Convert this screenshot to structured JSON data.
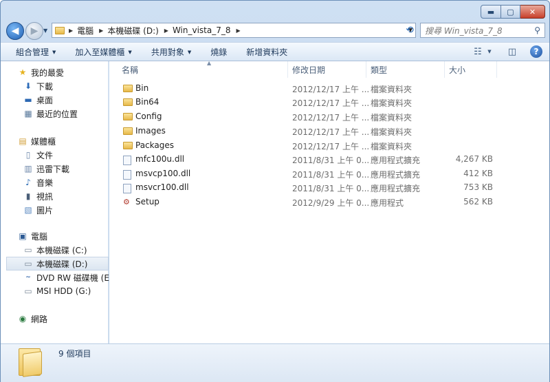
{
  "title_buttons": {
    "minimize": "▬",
    "maximize": "▢",
    "close": "✕"
  },
  "nav": {
    "back": "◀",
    "forward": "▶"
  },
  "address": {
    "crumbs": [
      "電腦",
      "本機磁碟 (D:)",
      "Win_vista_7_8"
    ]
  },
  "search": {
    "placeholder": "搜尋 Win_vista_7_8"
  },
  "toolbar": {
    "organize": "組合管理",
    "include_library": "加入至媒體櫃",
    "share_with": "共用對象",
    "burn": "燒錄",
    "new_folder": "新增資料夾"
  },
  "sidebar": {
    "favorites": {
      "label": "我的最愛",
      "items": [
        "下載",
        "桌面",
        "最近的位置"
      ]
    },
    "libraries": {
      "label": "媒體櫃",
      "items": [
        "文件",
        "迅雷下載",
        "音樂",
        "視訊",
        "圖片"
      ]
    },
    "computer": {
      "label": "電腦",
      "items": [
        "本機磁碟 (C:)",
        "本機磁碟 (D:)",
        "DVD RW 磁碟機 (E:)",
        "MSI HDD (G:)"
      ]
    },
    "network": {
      "label": "網路"
    }
  },
  "columns": {
    "name": "名稱",
    "date": "修改日期",
    "type": "類型",
    "size": "大小"
  },
  "files": [
    {
      "name": "Bin",
      "date": "2012/12/17 上午 ...",
      "type": "檔案資料夾",
      "size": "",
      "icon": "folder-icon"
    },
    {
      "name": "Bin64",
      "date": "2012/12/17 上午 ...",
      "type": "檔案資料夾",
      "size": "",
      "icon": "folder-icon"
    },
    {
      "name": "Config",
      "date": "2012/12/17 上午 ...",
      "type": "檔案資料夾",
      "size": "",
      "icon": "folder-icon"
    },
    {
      "name": "Images",
      "date": "2012/12/17 上午 ...",
      "type": "檔案資料夾",
      "size": "",
      "icon": "folder-icon"
    },
    {
      "name": "Packages",
      "date": "2012/12/17 上午 ...",
      "type": "檔案資料夾",
      "size": "",
      "icon": "folder-icon"
    },
    {
      "name": "mfc100u.dll",
      "date": "2011/8/31 上午 0...",
      "type": "應用程式擴充",
      "size": "4,267 KB",
      "icon": "dll-icon"
    },
    {
      "name": "msvcp100.dll",
      "date": "2011/8/31 上午 0...",
      "type": "應用程式擴充",
      "size": "412 KB",
      "icon": "dll-icon"
    },
    {
      "name": "msvcr100.dll",
      "date": "2011/8/31 上午 0...",
      "type": "應用程式擴充",
      "size": "753 KB",
      "icon": "dll-icon"
    },
    {
      "name": "Setup",
      "date": "2012/9/29 上午 0...",
      "type": "應用程式",
      "size": "562 KB",
      "icon": "setup-icon"
    }
  ],
  "status": {
    "item_count": "9 個項目"
  }
}
